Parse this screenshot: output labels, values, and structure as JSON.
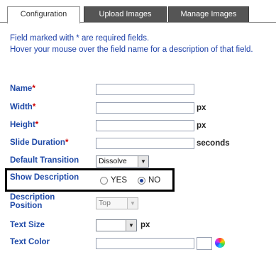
{
  "tabs": [
    {
      "label": "Configuration",
      "active": true
    },
    {
      "label": "Upload Images",
      "active": false
    },
    {
      "label": "Manage Images",
      "active": false
    }
  ],
  "notes": {
    "line1": "Field marked with * are required fields.",
    "line2": "Hover your mouse over the field name for a description of that field."
  },
  "required_marker": "*",
  "form": {
    "name": {
      "label": "Name",
      "value": ""
    },
    "width": {
      "label": "Width",
      "value": "",
      "unit": "px"
    },
    "height": {
      "label": "Height",
      "value": "",
      "unit": "px"
    },
    "slide_duration": {
      "label": "Slide Duration",
      "value": "",
      "unit": "seconds"
    },
    "default_transition": {
      "label": "Default Transition",
      "value": "Dissolve"
    },
    "show_description": {
      "label": "Show Description",
      "yes_label": "YES",
      "no_label": "NO",
      "selected": "NO"
    },
    "description_position": {
      "label_line1": "Description",
      "label_line2": "Position",
      "value": "Top"
    },
    "text_size": {
      "label": "Text Size",
      "value": "",
      "unit": "px"
    },
    "text_color": {
      "label": "Text Color",
      "value": ""
    }
  },
  "colors": {
    "label": "#1f4aa8",
    "required": "#cc0000",
    "tab_inactive": "#555555",
    "highlight": "#000000"
  },
  "icons": {
    "dropdown": "chevron-down-icon",
    "color_picker": "color-wheel-icon"
  }
}
